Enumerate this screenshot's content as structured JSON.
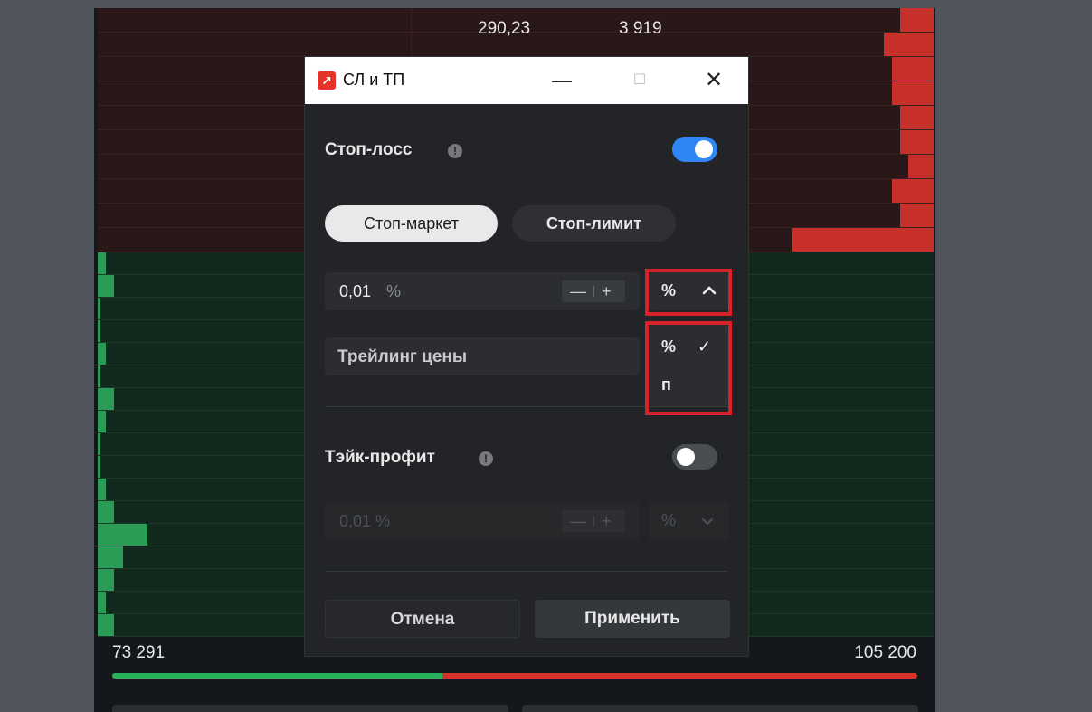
{
  "orderbook": {
    "visible_price": "290,23",
    "visible_quantity": "3 919",
    "buy_volume": "73 291",
    "sell_volume": "105 200",
    "buy_ratio": 0.41,
    "ask_bars": [
      0.04,
      0.06,
      0.05,
      0.05,
      0.04,
      0.04,
      0.03,
      0.05,
      0.04,
      0.17
    ],
    "bid_bars": [
      0.01,
      0.02,
      0.0,
      0.0,
      0.01,
      0.0,
      0.02,
      0.01,
      0.0,
      0.0,
      0.01,
      0.02,
      0.06,
      0.03,
      0.02,
      0.01,
      0.02
    ]
  },
  "dialog": {
    "app_icon_glyph": "↗",
    "title": "СЛ и ТП",
    "window_controls": {
      "minimize": "—",
      "maximize": "☐",
      "close": "✕"
    },
    "stop_loss": {
      "label": "Стоп-лосс",
      "info_glyph": "!",
      "enabled": true,
      "modes": {
        "market": "Стоп-маркет",
        "limit": "Стоп-лимит",
        "selected": "market"
      },
      "value": "0,01",
      "value_unit": "%",
      "stepper": {
        "minus": "—",
        "plus": "+"
      },
      "unit_select": {
        "value": "%",
        "chevron": "^"
      },
      "unit_options": [
        {
          "label": "%",
          "selected": true,
          "check": "✓"
        },
        {
          "label": "п",
          "selected": false
        }
      ],
      "trailing_label": "Трейлинг цены"
    },
    "take_profit": {
      "label": "Тэйк-профит",
      "info_glyph": "!",
      "enabled": false,
      "value": "0,01 %",
      "stepper": {
        "minus": "—",
        "plus": "+"
      },
      "unit_select": {
        "value": "%",
        "chevron": "v"
      }
    },
    "buttons": {
      "cancel": "Отмена",
      "apply": "Применить"
    }
  },
  "colors": {
    "accent_toggle": "#2f86f6",
    "ask": "#c8302c",
    "bid": "#2a9c56",
    "highlight": "#d8222a"
  }
}
